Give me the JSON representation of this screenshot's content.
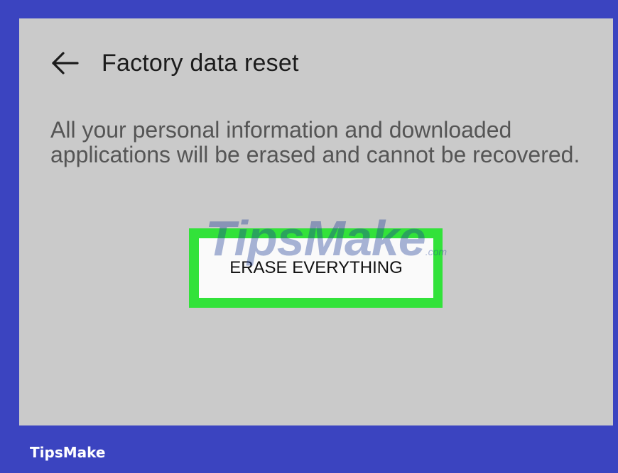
{
  "header": {
    "back_icon": "arrow-left-icon",
    "title": "Factory data reset"
  },
  "content": {
    "description": "All your personal information and downloaded applications will be erased and cannot be recovered."
  },
  "action": {
    "erase_label": "ERASE EVERYTHING",
    "highlight_color": "#32E23A"
  },
  "watermark": {
    "logo_text": "TipsMake",
    "logo_suffix": ".com"
  },
  "footer": {
    "brand": "TipsMake"
  },
  "colors": {
    "frame": "#3B44C0",
    "screen": "#CACACA",
    "button": "#FAFAFA"
  }
}
